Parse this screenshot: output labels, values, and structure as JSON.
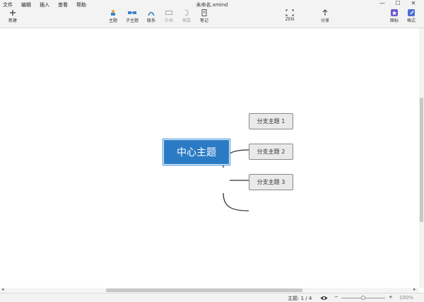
{
  "menu": [
    "文件",
    "编辑",
    "插入",
    "查看",
    "帮助"
  ],
  "document_title": "未命名.xmind",
  "window_controls": {
    "minimize": "—",
    "maximize": "☐",
    "close": "✕"
  },
  "toolbar": {
    "new": "新建",
    "topic": "主题",
    "subtopic": "子主题",
    "relationship": "联系",
    "boundary": "外框",
    "summary": "概要",
    "note": "笔记",
    "zen": "ZEN",
    "share": "分享",
    "icon": "图标",
    "format": "格式"
  },
  "mindmap": {
    "central": "中心主题",
    "branches": [
      "分支主题 1",
      "分支主题 2",
      "分支主题 3"
    ]
  },
  "status": {
    "topic_count": "主题: 1 / 4",
    "zoom_minus": "−",
    "zoom_plus": "+",
    "zoom_level": "100%",
    "zoom_fraction": 0.5
  }
}
